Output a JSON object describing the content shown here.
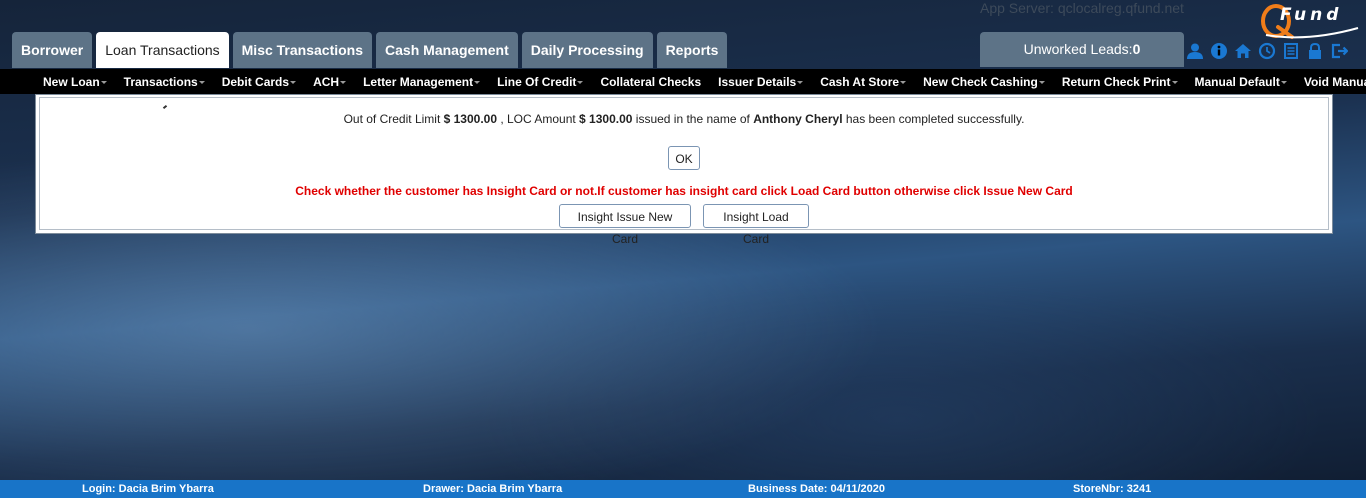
{
  "header": {
    "app_server": "App Server: qclocalreg.qfund.net",
    "logo_text": "Fund",
    "leads_label": "Unworked Leads:",
    "leads_count": "0"
  },
  "tabs": [
    {
      "label": "Borrower"
    },
    {
      "label": "Loan Transactions"
    },
    {
      "label": "Misc Transactions"
    },
    {
      "label": "Cash Management"
    },
    {
      "label": "Daily Processing"
    },
    {
      "label": "Reports"
    }
  ],
  "header_icons": [
    "user-icon",
    "info-icon",
    "home-icon",
    "clock-icon",
    "document-icon",
    "lock-icon",
    "logout-icon"
  ],
  "submenu": [
    {
      "label": "New Loan"
    },
    {
      "label": "Transactions"
    },
    {
      "label": "Debit Cards"
    },
    {
      "label": "ACH"
    },
    {
      "label": "Letter Management"
    },
    {
      "label": "Line Of Credit"
    },
    {
      "label": "Collateral Checks"
    },
    {
      "label": "Issuer Details"
    },
    {
      "label": "Cash At Store"
    },
    {
      "label": "New Check Cashing"
    },
    {
      "label": "Return Check Print"
    },
    {
      "label": "Manual Default"
    },
    {
      "label": "Void Manual Default"
    }
  ],
  "message": {
    "part1": "Out of Credit Limit ",
    "credit_limit": "$ 1300.00",
    "part2": " , LOC Amount ",
    "loc_amount": "$ 1300.00",
    "part3": " issued in the name of ",
    "customer_name": "Anthony Cheryl",
    "part4": " has been completed successfully."
  },
  "ok_label": "OK",
  "warning": "Check whether the customer has Insight Card or not.If customer has insight card click Load Card button otherwise click Issue New Card",
  "buttons": {
    "issue_new_card": "Insight Issue New Card",
    "load_card": "Insight Load Card"
  },
  "footer": {
    "login": "Login: Dacia Brim Ybarra",
    "drawer": "Drawer: Dacia Brim Ybarra",
    "business_date": "Business Date: 04/11/2020",
    "store": "StoreNbr: 3241"
  },
  "colors": {
    "tab_bg": "#5d7387",
    "submenu_bg": "#000000",
    "footer_bg": "#1874c8",
    "warning": "#e00000",
    "icon_blue": "#1a78d2"
  }
}
